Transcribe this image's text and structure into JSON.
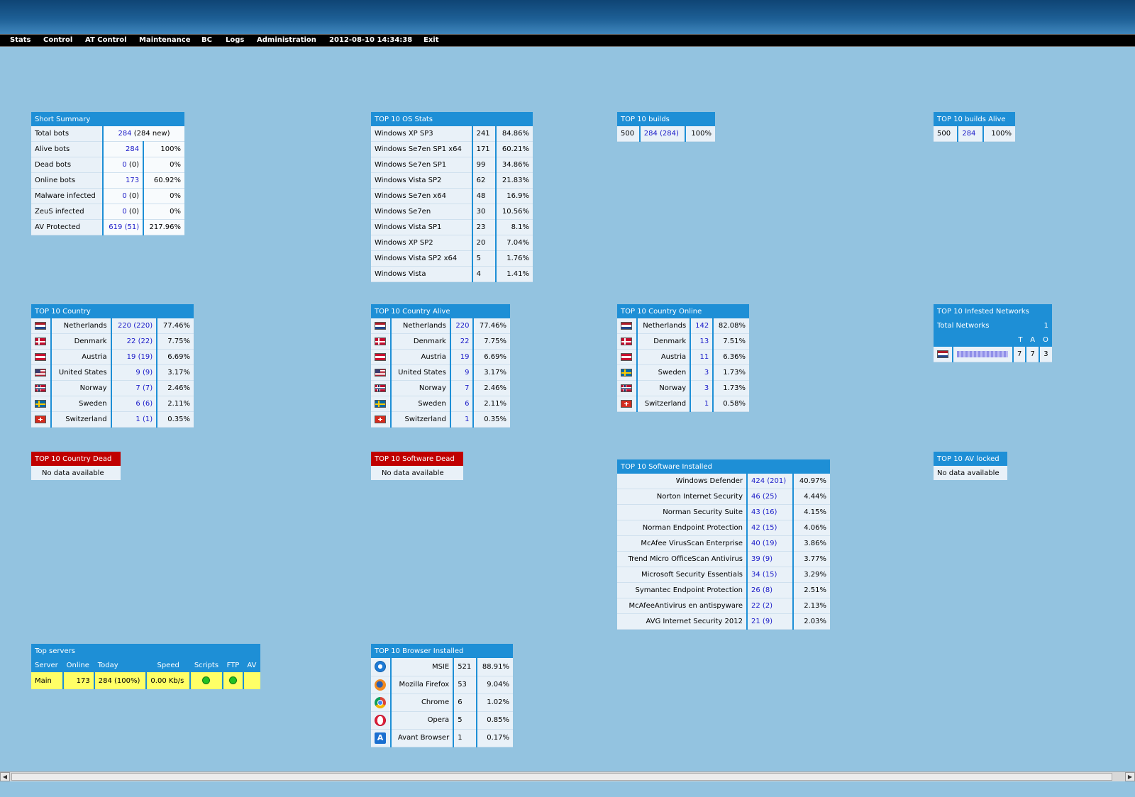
{
  "menu": [
    "Stats",
    "Control",
    "AT Control",
    "Maintenance",
    "BC",
    "Logs",
    "Administration",
    "2012-08-10 14:34:38",
    "Exit"
  ],
  "short_summary": {
    "title": "Short Summary",
    "rows": [
      {
        "label": "Total bots",
        "value": "284",
        "paren": "(284 new)",
        "pct": ""
      },
      {
        "label": "Alive bots",
        "value": "284",
        "paren": "",
        "pct": "100%"
      },
      {
        "label": "Dead bots",
        "value": "0",
        "paren": "(0)",
        "pct": "0%"
      },
      {
        "label": "Online bots",
        "value": "173",
        "paren": "",
        "pct": "60.92%"
      },
      {
        "label": "Malware infected",
        "value": "0",
        "paren": "(0)",
        "pct": "0%"
      },
      {
        "label": "ZeuS infected",
        "value": "0",
        "paren": "(0)",
        "pct": "0%"
      },
      {
        "label": "AV Protected",
        "value": "619",
        "paren": "(51)",
        "pct": "217.96%"
      }
    ]
  },
  "os_stats": {
    "title": "TOP 10 OS Stats",
    "rows": [
      {
        "name": "Windows XP SP3",
        "count": "241",
        "pct": "84.86%"
      },
      {
        "name": "Windows Se7en SP1 x64",
        "count": "171",
        "pct": "60.21%"
      },
      {
        "name": "Windows Se7en SP1",
        "count": "99",
        "pct": "34.86%"
      },
      {
        "name": "Windows Vista SP2",
        "count": "62",
        "pct": "21.83%"
      },
      {
        "name": "Windows Se7en x64",
        "count": "48",
        "pct": "16.9%"
      },
      {
        "name": "Windows Se7en",
        "count": "30",
        "pct": "10.56%"
      },
      {
        "name": "Windows Vista SP1",
        "count": "23",
        "pct": "8.1%"
      },
      {
        "name": "Windows XP SP2",
        "count": "20",
        "pct": "7.04%"
      },
      {
        "name": "Windows Vista SP2 x64",
        "count": "5",
        "pct": "1.76%"
      },
      {
        "name": "Windows Vista",
        "count": "4",
        "pct": "1.41%"
      }
    ]
  },
  "builds": {
    "title": "TOP 10 builds",
    "build": "500",
    "value": "284",
    "paren": "(284)",
    "pct": "100%"
  },
  "builds_alive": {
    "title": "TOP 10 builds Alive",
    "build": "500",
    "value": "284",
    "pct": "100%"
  },
  "country": {
    "title": "TOP 10 Country",
    "rows": [
      {
        "flag": "nl",
        "name": "Netherlands",
        "value": "220",
        "paren": "(220)",
        "pct": "77.46%"
      },
      {
        "flag": "dk",
        "name": "Denmark",
        "value": "22",
        "paren": "(22)",
        "pct": "7.75%"
      },
      {
        "flag": "at",
        "name": "Austria",
        "value": "19",
        "paren": "(19)",
        "pct": "6.69%"
      },
      {
        "flag": "us",
        "name": "United States",
        "value": "9",
        "paren": "(9)",
        "pct": "3.17%"
      },
      {
        "flag": "no",
        "name": "Norway",
        "value": "7",
        "paren": "(7)",
        "pct": "2.46%"
      },
      {
        "flag": "se",
        "name": "Sweden",
        "value": "6",
        "paren": "(6)",
        "pct": "2.11%"
      },
      {
        "flag": "ch",
        "name": "Switzerland",
        "value": "1",
        "paren": "(1)",
        "pct": "0.35%"
      }
    ]
  },
  "country_alive": {
    "title": "TOP 10 Country Alive",
    "rows": [
      {
        "flag": "nl",
        "name": "Netherlands",
        "value": "220",
        "pct": "77.46%"
      },
      {
        "flag": "dk",
        "name": "Denmark",
        "value": "22",
        "pct": "7.75%"
      },
      {
        "flag": "at",
        "name": "Austria",
        "value": "19",
        "pct": "6.69%"
      },
      {
        "flag": "us",
        "name": "United States",
        "value": "9",
        "pct": "3.17%"
      },
      {
        "flag": "no",
        "name": "Norway",
        "value": "7",
        "pct": "2.46%"
      },
      {
        "flag": "se",
        "name": "Sweden",
        "value": "6",
        "pct": "2.11%"
      },
      {
        "flag": "ch",
        "name": "Switzerland",
        "value": "1",
        "pct": "0.35%"
      }
    ]
  },
  "country_online": {
    "title": "TOP 10 Country Online",
    "rows": [
      {
        "flag": "nl",
        "name": "Netherlands",
        "value": "142",
        "pct": "82.08%"
      },
      {
        "flag": "dk",
        "name": "Denmark",
        "value": "13",
        "pct": "7.51%"
      },
      {
        "flag": "at",
        "name": "Austria",
        "value": "11",
        "pct": "6.36%"
      },
      {
        "flag": "se",
        "name": "Sweden",
        "value": "3",
        "pct": "1.73%"
      },
      {
        "flag": "no",
        "name": "Norway",
        "value": "3",
        "pct": "1.73%"
      },
      {
        "flag": "ch",
        "name": "Switzerland",
        "value": "1",
        "pct": "0.58%"
      }
    ]
  },
  "infested": {
    "title": "TOP 10 Infested Networks",
    "total_label": "Total Networks",
    "total_value": "1",
    "cols": [
      "T",
      "A",
      "O"
    ],
    "row": {
      "flag": "nl",
      "t": "7",
      "a": "7",
      "o": "3"
    }
  },
  "country_dead": {
    "title": "TOP 10 Country Dead",
    "message": "No data available"
  },
  "software_dead": {
    "title": "TOP 10 Software Dead",
    "message": "No data available"
  },
  "av_locked": {
    "title": "TOP 10 AV locked",
    "message": "No data available"
  },
  "software_installed": {
    "title": "TOP 10 Software Installed",
    "rows": [
      {
        "name": "Windows Defender",
        "value": "424",
        "paren": "(201)",
        "pct": "40.97%"
      },
      {
        "name": "Norton Internet Security",
        "value": "46",
        "paren": "(25)",
        "pct": "4.44%"
      },
      {
        "name": "Norman Security Suite",
        "value": "43",
        "paren": "(16)",
        "pct": "4.15%"
      },
      {
        "name": "Norman Endpoint Protection",
        "value": "42",
        "paren": "(15)",
        "pct": "4.06%"
      },
      {
        "name": "McAfee VirusScan Enterprise",
        "value": "40",
        "paren": "(19)",
        "pct": "3.86%"
      },
      {
        "name": "Trend Micro OfficeScan Antivirus",
        "value": "39",
        "paren": "(9)",
        "pct": "3.77%"
      },
      {
        "name": "Microsoft Security Essentials",
        "value": "34",
        "paren": "(15)",
        "pct": "3.29%"
      },
      {
        "name": "Symantec Endpoint Protection",
        "value": "26",
        "paren": "(8)",
        "pct": "2.51%"
      },
      {
        "name": "McAfeeAntivirus en antispyware",
        "value": "22",
        "paren": "(2)",
        "pct": "2.13%"
      },
      {
        "name": "AVG Internet Security 2012",
        "value": "21",
        "paren": "(9)",
        "pct": "2.03%"
      }
    ]
  },
  "top_servers": {
    "title": "Top servers",
    "cols": [
      "Server",
      "Online",
      "Today",
      "Speed",
      "Scripts",
      "FTP",
      "AV"
    ],
    "row": {
      "server": "Main",
      "online": "173",
      "today": "284 (100%)",
      "speed": "0.00 Kb/s",
      "status_color": "#22c022"
    }
  },
  "browsers": {
    "title": "TOP 10 Browser Installed",
    "rows": [
      {
        "icon": "ie-icon",
        "name": "MSIE",
        "count": "521",
        "pct": "88.91%"
      },
      {
        "icon": "firefox-icon",
        "name": "Mozilla Firefox",
        "count": "53",
        "pct": "9.04%"
      },
      {
        "icon": "chrome-icon",
        "name": "Chrome",
        "count": "6",
        "pct": "1.02%"
      },
      {
        "icon": "opera-icon",
        "name": "Opera",
        "count": "5",
        "pct": "0.85%"
      },
      {
        "icon": "avant-icon",
        "name": "Avant Browser",
        "count": "1",
        "pct": "0.17%"
      }
    ]
  }
}
